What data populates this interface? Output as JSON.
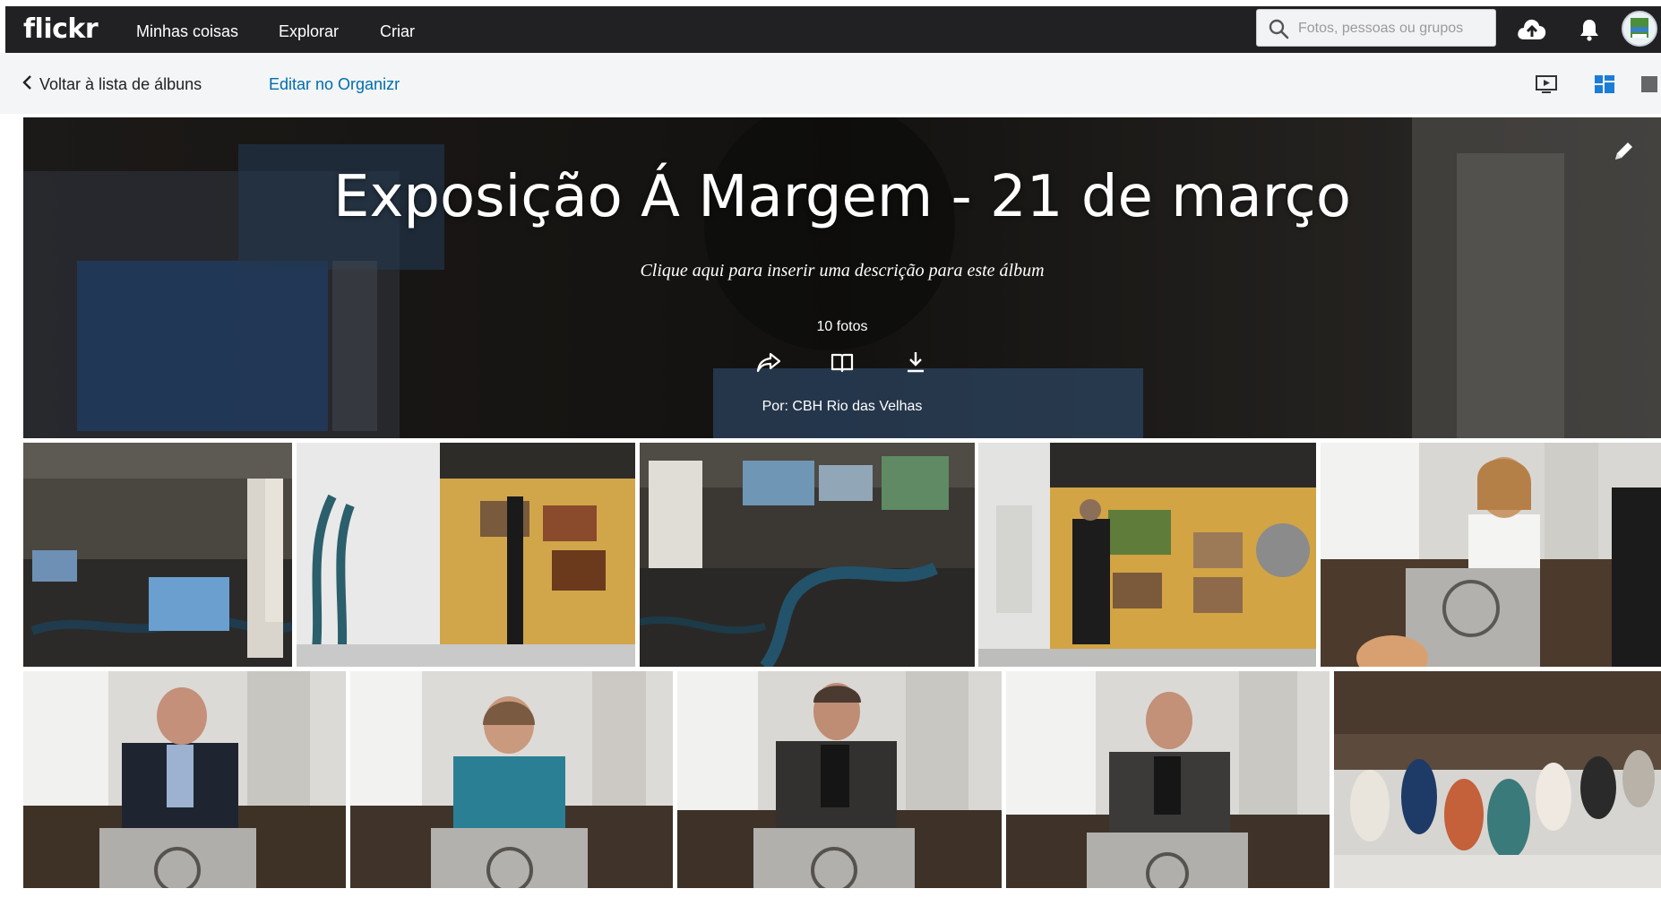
{
  "topbar": {
    "logo": "flickr",
    "nav": [
      "Minhas coisas",
      "Explorar",
      "Criar"
    ],
    "search_placeholder": "Fotos, pessoas ou grupos",
    "icons": [
      "search-icon",
      "upload-cloud-icon",
      "notification-bell-icon",
      "avatar"
    ]
  },
  "subnav": {
    "back_label": "Voltar à lista de álbuns",
    "edit_label": "Editar no Organizr",
    "view_icons": [
      "slideshow-icon",
      "grid-view-icon",
      "single-view-icon"
    ]
  },
  "album": {
    "title": "Exposição Á Margem - 21 de março",
    "description": "Clique aqui para inserir uma descrição para este álbum",
    "count": "10 fotos",
    "byline": "Por: CBH Rio das Velhas",
    "actions": [
      "share-icon",
      "book-icon",
      "download-icon"
    ]
  },
  "colors": {
    "topbar": "#212124",
    "link": "#006dac",
    "active_view": "#1c7dd6"
  },
  "photos": [
    {
      "name": "photo-exhibition-hall-1"
    },
    {
      "name": "photo-agua-cultura-wall"
    },
    {
      "name": "photo-exhibition-hall-2"
    },
    {
      "name": "photo-visitor-at-panel"
    },
    {
      "name": "photo-speaker-woman-white"
    },
    {
      "name": "photo-speaker-man-bald"
    },
    {
      "name": "photo-speaker-woman-glasses"
    },
    {
      "name": "photo-speaker-man-gray-1"
    },
    {
      "name": "photo-speaker-man-gray-2"
    },
    {
      "name": "photo-audience"
    }
  ]
}
